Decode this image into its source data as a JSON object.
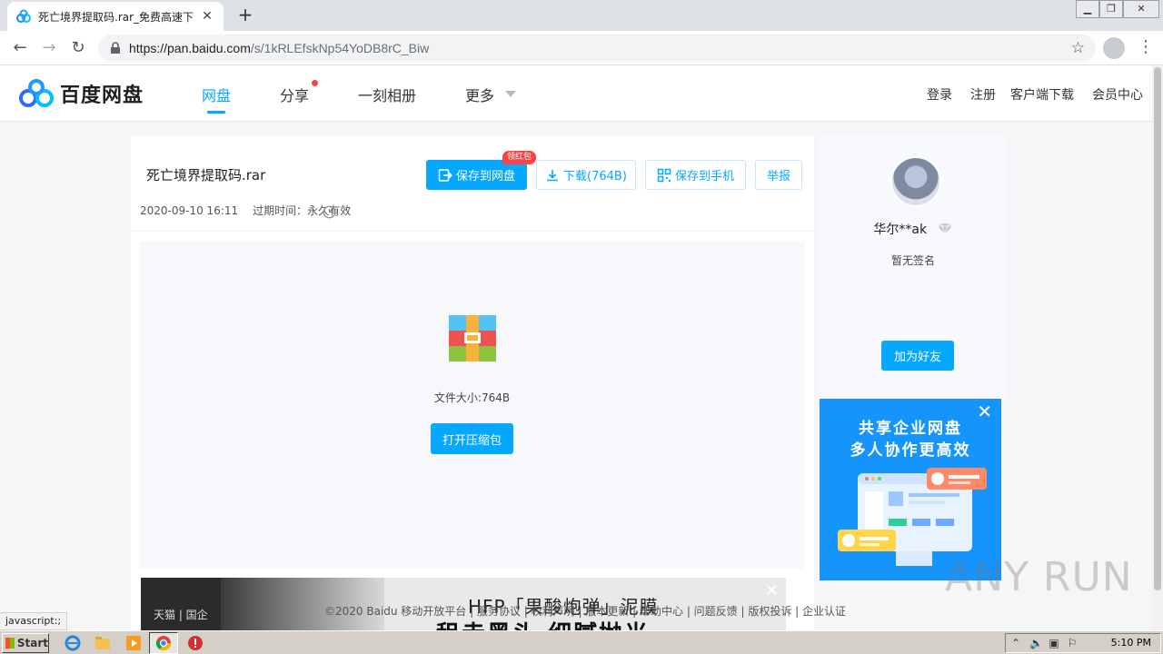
{
  "browser": {
    "tab_title": "死亡境界提取码.rar_免费高速下载|百",
    "url_host": "https://pan.baidu.com",
    "url_path": "/s/1kRLEfskNp54YoDB8rC_Biw",
    "status_text": "javascript:;"
  },
  "header": {
    "logo_text": "百度网盘",
    "nav": [
      "网盘",
      "分享",
      "一刻相册",
      "更多"
    ],
    "right_links": [
      "登录",
      "注册",
      "客户端下载",
      "会员中心"
    ]
  },
  "file": {
    "name": "死亡境界提取码.rar",
    "date": "2020-09-10 16:11",
    "expire": "过期时间：永久有效",
    "size_label": "文件大小:764B",
    "open_button": "打开压缩包"
  },
  "actions": {
    "save": "保存到网盘",
    "save_badge": "领红包",
    "download": "下载(764B)",
    "save_phone": "保存到手机",
    "report": "举报"
  },
  "profile": {
    "username": "华尔**ak",
    "signature": "暂无签名",
    "add_friend": "加为好友"
  },
  "side_ad": {
    "line1": "共享企业网盘",
    "line2": "多人协作更高效"
  },
  "bottom_ad": {
    "left_text": "天猫 | 国企",
    "line1": "HFP「果酸炮弹」泥膜",
    "line2": "租走黑头 细腻抛光"
  },
  "footer": "©2020 Baidu 移动开放平台 | 服务协议 | 权利声明 | 版本更新 | 帮助中心 | 问题反馈 | 版权投诉 | 企业认证",
  "watermark": "ANY RUN",
  "taskbar": {
    "start": "Start",
    "time": "5:10 PM"
  },
  "colors": {
    "accent": "#06a7ff",
    "badge": "#f74545"
  }
}
